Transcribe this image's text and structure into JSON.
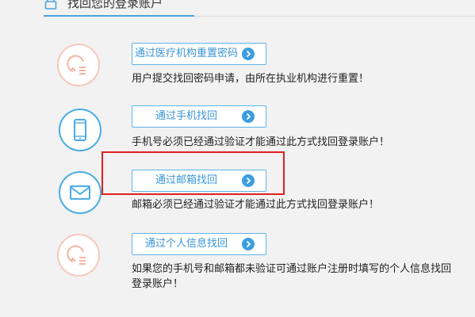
{
  "header": {
    "title": "找回您的登录账户"
  },
  "options": [
    {
      "button_label": "通过医疗机构重置密码",
      "description": "用户提交找回密码申请，由所在执业机构进行重置！",
      "icon": "reset-icon"
    },
    {
      "button_label": "通过手机找回",
      "description": "手机号必须已经通过验证才能通过此方式找回登录账户！",
      "icon": "phone-icon"
    },
    {
      "button_label": "通过邮箱找回",
      "description": "邮箱必须已经通过验证才能通过此方式找回登录账户！",
      "icon": "mail-icon"
    },
    {
      "button_label": "通过个人信息找回",
      "description_line1": "如果您的手机号和邮箱都未验证可通过账户注册时填写的个人信息找回",
      "description_line2": "登录账户！",
      "icon": "reset-icon"
    }
  ],
  "colors": {
    "accent_blue": "#3b9ee0",
    "peach": "#f7c8bb",
    "highlight_red": "#e21f1f",
    "background": "#f2f2f2"
  }
}
